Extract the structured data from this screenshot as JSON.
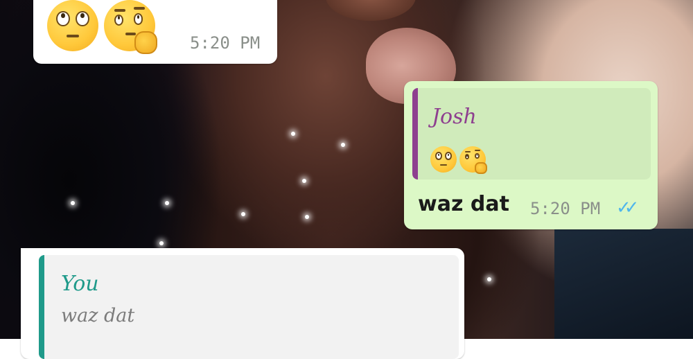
{
  "messages": [
    {
      "direction": "incoming",
      "emojis": [
        "face-with-rolling-eyes",
        "thinking-face"
      ],
      "time": "5:20 PM"
    },
    {
      "direction": "outgoing",
      "reply_to": {
        "sender": "Josh",
        "emojis": [
          "face-with-rolling-eyes",
          "thinking-face"
        ]
      },
      "text": "waz dat",
      "time": "5:20 PM",
      "status": "read"
    },
    {
      "direction": "incoming",
      "reply_to": {
        "sender": "You",
        "text": "waz dat"
      }
    }
  ],
  "colors": {
    "incoming_bubble": "#ffffff",
    "outgoing_bubble": "#dcf8c6",
    "quote_josh": "#8e3f8f",
    "quote_you": "#1f9a8a",
    "read_ticks": "#4fb6ec"
  }
}
